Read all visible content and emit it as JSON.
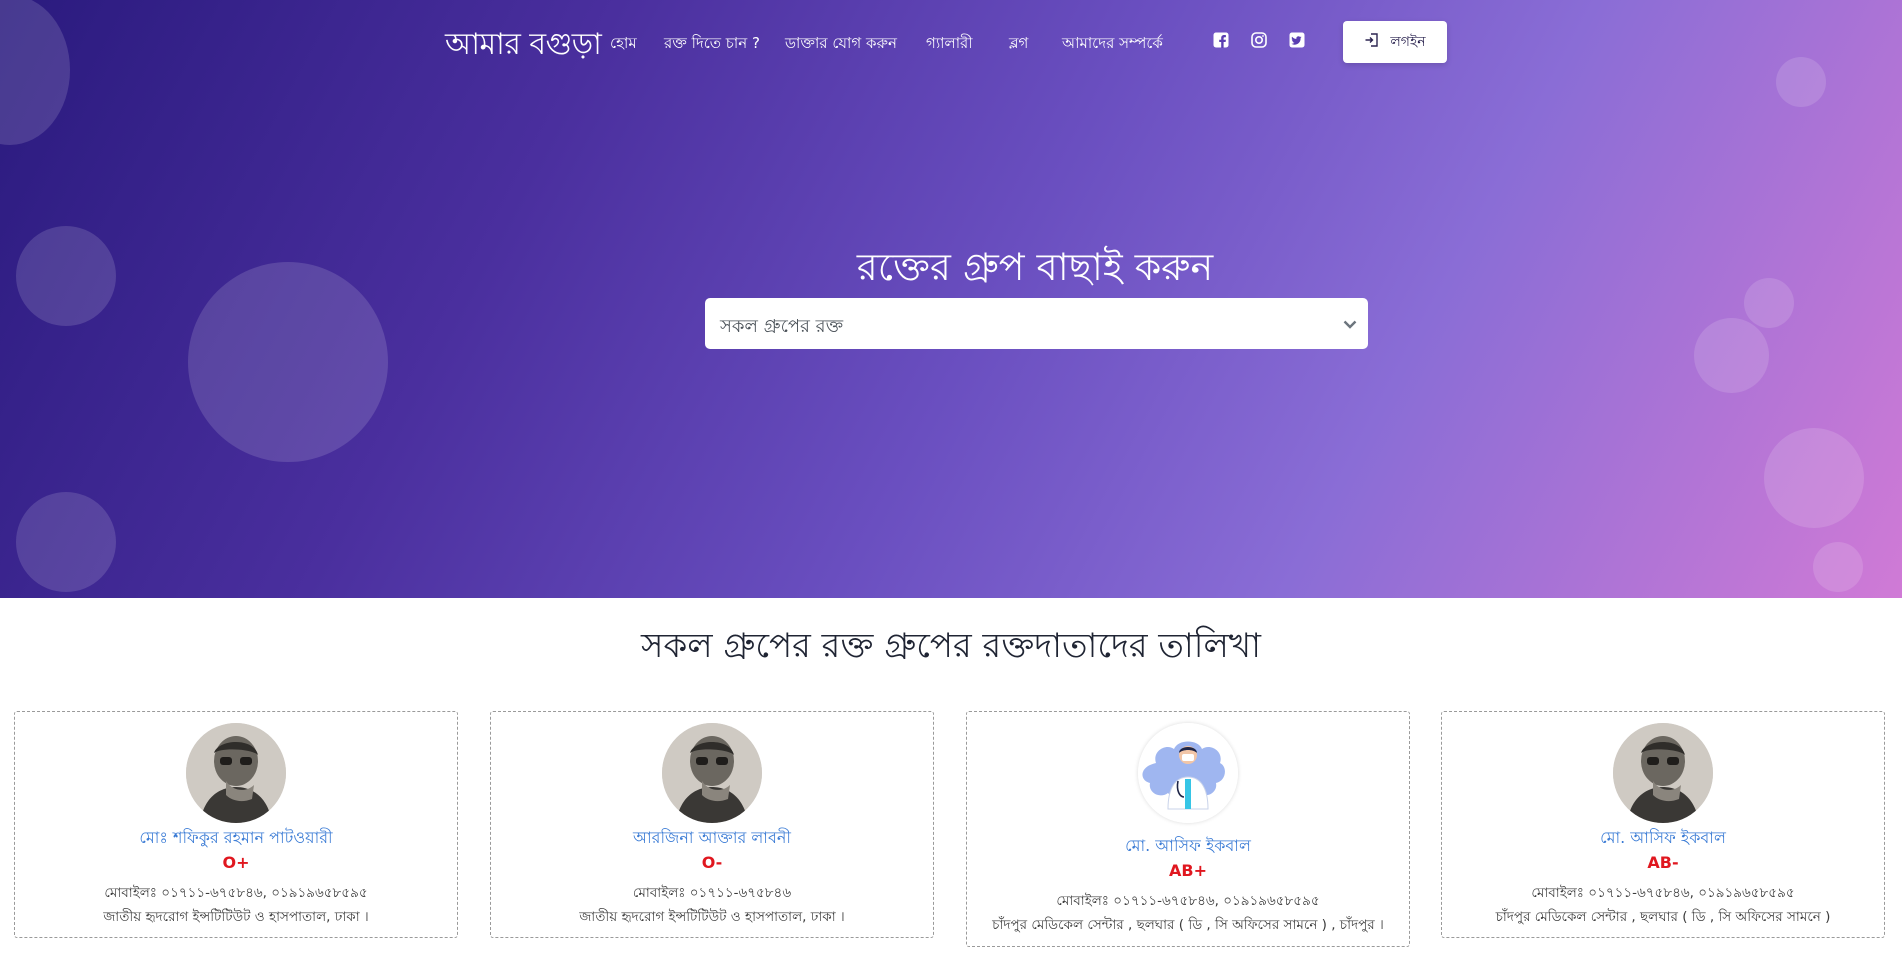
{
  "brand": {
    "logo_text": "আমার বগুড়া"
  },
  "nav": {
    "items": [
      {
        "label": "হোম"
      },
      {
        "label": "রক্ত দিতে চান ?"
      },
      {
        "label": "ডাক্তার যোগ করুন"
      },
      {
        "label": "গ্যালারী"
      },
      {
        "label": "ব্লগ"
      },
      {
        "label": "আমাদের সম্পর্কে"
      }
    ],
    "social": [
      {
        "icon": "facebook-icon"
      },
      {
        "icon": "instagram-icon"
      },
      {
        "icon": "twitter-icon"
      }
    ],
    "login_label": "লগইন"
  },
  "hero": {
    "title": "রক্তের গ্রুপ বাছাই করুন",
    "select_value": "সকল গ্রুপের রক্ত"
  },
  "list": {
    "title": "সকল গ্রুপের রক্ত গ্রুপের রক্তদাতাদের তালিখা",
    "donors": [
      {
        "name": "মোঃ শফিকুর রহমান পাটওয়ারী",
        "blood_group": "O+",
        "phone": "মোবাইলঃ ০১৭১১-৬৭৫৮৪৬, ০১৯১৯৬৫৮৫৯৫",
        "address": "জাতীয় হৃদরোগ ইন্সটিটিউট ও হাসপাতাল, ঢাকা ।",
        "avatar": "portrait-photo"
      },
      {
        "name": "আরজিনা আক্তার লাবনী",
        "blood_group": "O-",
        "phone": "মোবাইলঃ ০১৭১১-৬৭৫৮৪৬",
        "address": "জাতীয় হৃদরোগ ইন্সটিটিউট ও হাসপাতাল, ঢাকা ।",
        "avatar": "portrait-photo"
      },
      {
        "name": "মো. আসিফ ইকবাল",
        "blood_group": "AB+",
        "phone": "মোবাইলঃ ০১৭১১-৬৭৫৮৪৬, ০১৯১৯৬৫৮৫৯৫",
        "address": "চাঁদপুর মেডিকেল সেন্টার , ছলঘার ( ডি , সি অফিসের সামনে ) , চাঁদপুর ।",
        "avatar": "doctor-illustration"
      },
      {
        "name": "মো. আসিফ ইকবাল",
        "blood_group": "AB-",
        "phone": "মোবাইলঃ ০১৭১১-৬৭৫৮৪৬, ০১৯১৯৬৫৮৫৯৫",
        "address": "চাঁদপুর মেডিকেল সেন্টার , ছলঘার ( ডি , সি অফিসের সামনে )",
        "avatar": "portrait-photo"
      }
    ]
  },
  "colors": {
    "accent_name": "#3a7bd5",
    "blood_group": "#e0171f",
    "hero_start": "#2a1a7e",
    "hero_end": "#d07ad6"
  }
}
